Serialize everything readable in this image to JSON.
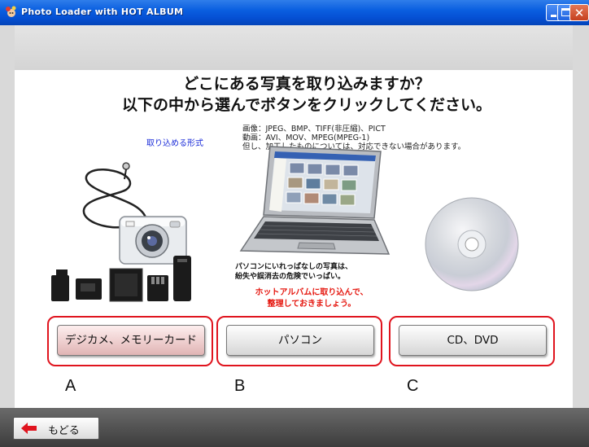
{
  "window": {
    "title": "Photo Loader with HOT ALBUM"
  },
  "heading": {
    "line1": "どこにある写真を取り込みますか？",
    "line2": "以下の中から選んでボタンをクリックしてください。"
  },
  "formats": {
    "link_label": "取り込める形式",
    "line1": "画像：JPEG、BMP、TIFF(非圧縮)、PICT",
    "line2": "動画：AVI、MOV、MPEG(MPEG-1)",
    "line3": "但し、加工したものについては、対応できない場合があります。"
  },
  "notice": {
    "line1": "パソコンにいれっぱなしの写真は、",
    "line2": "紛失や誤消去の危険でいっぱい。",
    "line3": "ホットアルバムに取り込んで、",
    "line4": "整理しておきましょう。"
  },
  "options": [
    {
      "label": "デジカメ、メモリーカード",
      "letter": "A"
    },
    {
      "label": "パソコン",
      "letter": "B"
    },
    {
      "label": "CD、DVD",
      "letter": "C"
    }
  ],
  "footer": {
    "back_label": "もどる"
  },
  "colors": {
    "accent_red": "#e0141e",
    "link_blue": "#1a2bd8",
    "titlebar_blue": "#0550d4"
  }
}
